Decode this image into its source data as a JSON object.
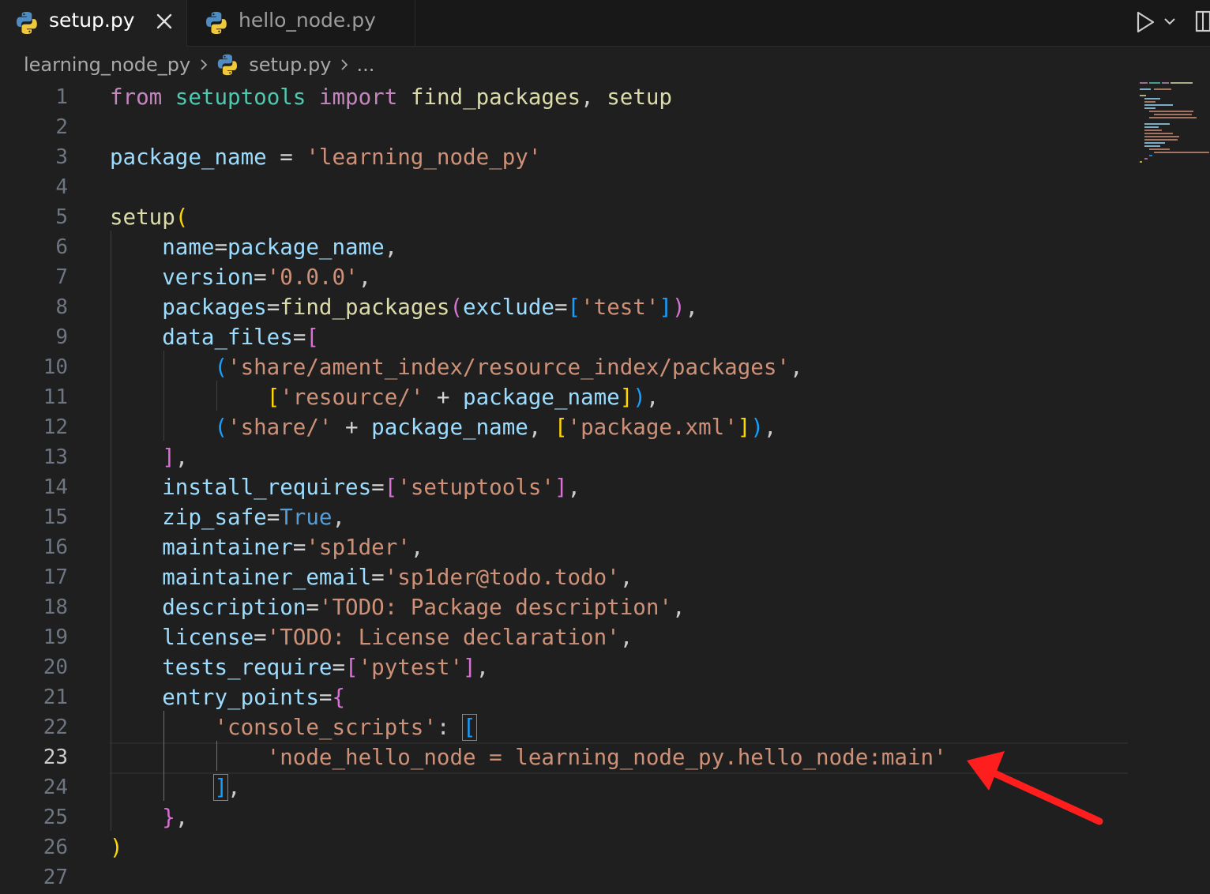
{
  "tabs": [
    {
      "label": "setup.py",
      "active": true,
      "icon": "python-icon"
    },
    {
      "label": "hello_node.py",
      "active": false,
      "icon": "python-icon"
    }
  ],
  "toolbar": {
    "run_icon": "play-icon",
    "run_menu_icon": "chevron-down-icon",
    "split_icon": "split-editor-icon"
  },
  "breadcrumb": {
    "folder": "learning_node_py",
    "file": "setup.py",
    "more": "..."
  },
  "editor": {
    "current_line": 23,
    "lines": [
      {
        "n": "1",
        "tokens": [
          {
            "t": "from",
            "c": "kw"
          },
          {
            "t": " "
          },
          {
            "t": "setuptools",
            "c": "mod"
          },
          {
            "t": " "
          },
          {
            "t": "import",
            "c": "kw"
          },
          {
            "t": " "
          },
          {
            "t": "find_packages",
            "c": "fn"
          },
          {
            "t": ", "
          },
          {
            "t": "setup",
            "c": "fn"
          }
        ]
      },
      {
        "n": "2",
        "tokens": []
      },
      {
        "n": "3",
        "tokens": [
          {
            "t": "package_name",
            "c": "var"
          },
          {
            "t": " = ",
            "c": "op"
          },
          {
            "t": "'learning_node_py'",
            "c": "str"
          }
        ]
      },
      {
        "n": "4",
        "tokens": []
      },
      {
        "n": "5",
        "tokens": [
          {
            "t": "setup",
            "c": "fn"
          },
          {
            "t": "(",
            "c": "p1"
          }
        ]
      },
      {
        "n": "6",
        "tokens": [
          {
            "t": "    "
          },
          {
            "t": "name",
            "c": "var"
          },
          {
            "t": "=",
            "c": "op"
          },
          {
            "t": "package_name",
            "c": "var"
          },
          {
            "t": ","
          }
        ]
      },
      {
        "n": "7",
        "tokens": [
          {
            "t": "    "
          },
          {
            "t": "version",
            "c": "var"
          },
          {
            "t": "=",
            "c": "op"
          },
          {
            "t": "'0.0.0'",
            "c": "str"
          },
          {
            "t": ","
          }
        ]
      },
      {
        "n": "8",
        "tokens": [
          {
            "t": "    "
          },
          {
            "t": "packages",
            "c": "var"
          },
          {
            "t": "=",
            "c": "op"
          },
          {
            "t": "find_packages",
            "c": "fn"
          },
          {
            "t": "(",
            "c": "p2"
          },
          {
            "t": "exclude",
            "c": "var"
          },
          {
            "t": "=",
            "c": "op"
          },
          {
            "t": "[",
            "c": "p3"
          },
          {
            "t": "'test'",
            "c": "str"
          },
          {
            "t": "]",
            "c": "p3"
          },
          {
            "t": ")",
            "c": "p2"
          },
          {
            "t": ","
          }
        ]
      },
      {
        "n": "9",
        "tokens": [
          {
            "t": "    "
          },
          {
            "t": "data_files",
            "c": "var"
          },
          {
            "t": "=",
            "c": "op"
          },
          {
            "t": "[",
            "c": "p2"
          }
        ]
      },
      {
        "n": "10",
        "tokens": [
          {
            "t": "        "
          },
          {
            "t": "(",
            "c": "p3"
          },
          {
            "t": "'share/ament_index/resource_index/packages'",
            "c": "str"
          },
          {
            "t": ","
          }
        ]
      },
      {
        "n": "11",
        "tokens": [
          {
            "t": "            "
          },
          {
            "t": "[",
            "c": "p1"
          },
          {
            "t": "'resource/'",
            "c": "str"
          },
          {
            "t": " + ",
            "c": "op"
          },
          {
            "t": "package_name",
            "c": "var"
          },
          {
            "t": "]",
            "c": "p1"
          },
          {
            "t": ")",
            "c": "p3"
          },
          {
            "t": ","
          }
        ]
      },
      {
        "n": "12",
        "tokens": [
          {
            "t": "        "
          },
          {
            "t": "(",
            "c": "p3"
          },
          {
            "t": "'share/'",
            "c": "str"
          },
          {
            "t": " + ",
            "c": "op"
          },
          {
            "t": "package_name",
            "c": "var"
          },
          {
            "t": ", "
          },
          {
            "t": "[",
            "c": "p1"
          },
          {
            "t": "'package.xml'",
            "c": "str"
          },
          {
            "t": "]",
            "c": "p1"
          },
          {
            "t": ")",
            "c": "p3"
          },
          {
            "t": ","
          }
        ]
      },
      {
        "n": "13",
        "tokens": [
          {
            "t": "    "
          },
          {
            "t": "]",
            "c": "p2"
          },
          {
            "t": ","
          }
        ]
      },
      {
        "n": "14",
        "tokens": [
          {
            "t": "    "
          },
          {
            "t": "install_requires",
            "c": "var"
          },
          {
            "t": "=",
            "c": "op"
          },
          {
            "t": "[",
            "c": "p2"
          },
          {
            "t": "'setuptools'",
            "c": "str"
          },
          {
            "t": "]",
            "c": "p2"
          },
          {
            "t": ","
          }
        ]
      },
      {
        "n": "15",
        "tokens": [
          {
            "t": "    "
          },
          {
            "t": "zip_safe",
            "c": "var"
          },
          {
            "t": "=",
            "c": "op"
          },
          {
            "t": "True",
            "c": "const"
          },
          {
            "t": ","
          }
        ]
      },
      {
        "n": "16",
        "tokens": [
          {
            "t": "    "
          },
          {
            "t": "maintainer",
            "c": "var"
          },
          {
            "t": "=",
            "c": "op"
          },
          {
            "t": "'sp1der'",
            "c": "str"
          },
          {
            "t": ","
          }
        ]
      },
      {
        "n": "17",
        "tokens": [
          {
            "t": "    "
          },
          {
            "t": "maintainer_email",
            "c": "var"
          },
          {
            "t": "=",
            "c": "op"
          },
          {
            "t": "'sp1der@todo.todo'",
            "c": "str"
          },
          {
            "t": ","
          }
        ]
      },
      {
        "n": "18",
        "tokens": [
          {
            "t": "    "
          },
          {
            "t": "description",
            "c": "var"
          },
          {
            "t": "=",
            "c": "op"
          },
          {
            "t": "'TODO: Package description'",
            "c": "str"
          },
          {
            "t": ","
          }
        ]
      },
      {
        "n": "19",
        "tokens": [
          {
            "t": "    "
          },
          {
            "t": "license",
            "c": "var"
          },
          {
            "t": "=",
            "c": "op"
          },
          {
            "t": "'TODO: License declaration'",
            "c": "str"
          },
          {
            "t": ","
          }
        ]
      },
      {
        "n": "20",
        "tokens": [
          {
            "t": "    "
          },
          {
            "t": "tests_require",
            "c": "var"
          },
          {
            "t": "=",
            "c": "op"
          },
          {
            "t": "[",
            "c": "p2"
          },
          {
            "t": "'pytest'",
            "c": "str"
          },
          {
            "t": "]",
            "c": "p2"
          },
          {
            "t": ","
          }
        ]
      },
      {
        "n": "21",
        "tokens": [
          {
            "t": "    "
          },
          {
            "t": "entry_points",
            "c": "var"
          },
          {
            "t": "=",
            "c": "op"
          },
          {
            "t": "{",
            "c": "p2"
          }
        ]
      },
      {
        "n": "22",
        "tokens": [
          {
            "t": "        "
          },
          {
            "t": "'console_scripts'",
            "c": "str"
          },
          {
            "t": ": "
          },
          {
            "t": "[",
            "c": "p3 bm"
          }
        ]
      },
      {
        "n": "23",
        "tokens": [
          {
            "t": "            "
          },
          {
            "t": "'node_hello_node = learning_node_py.hello_node:main'",
            "c": "str"
          }
        ]
      },
      {
        "n": "24",
        "tokens": [
          {
            "t": "        "
          },
          {
            "t": "]",
            "c": "p3 bm"
          },
          {
            "t": ","
          }
        ]
      },
      {
        "n": "25",
        "tokens": [
          {
            "t": "    "
          },
          {
            "t": "}",
            "c": "p2"
          },
          {
            "t": ","
          }
        ]
      },
      {
        "n": "26",
        "tokens": [
          {
            "t": ")",
            "c": "p1"
          }
        ]
      },
      {
        "n": "27",
        "tokens": []
      }
    ]
  },
  "colors": {
    "background": "#1f1f1f",
    "tabbar": "#181818",
    "keyword": "#c586c0",
    "module": "#4ec9b0",
    "function": "#dcdcaa",
    "variable": "#9cdcfe",
    "string": "#ce9178",
    "constant": "#569cd6",
    "bracket_gold": "#ffd700",
    "bracket_orchid": "#da70d6",
    "bracket_blue": "#179fff",
    "annotation_arrow": "#ff1e1e"
  }
}
